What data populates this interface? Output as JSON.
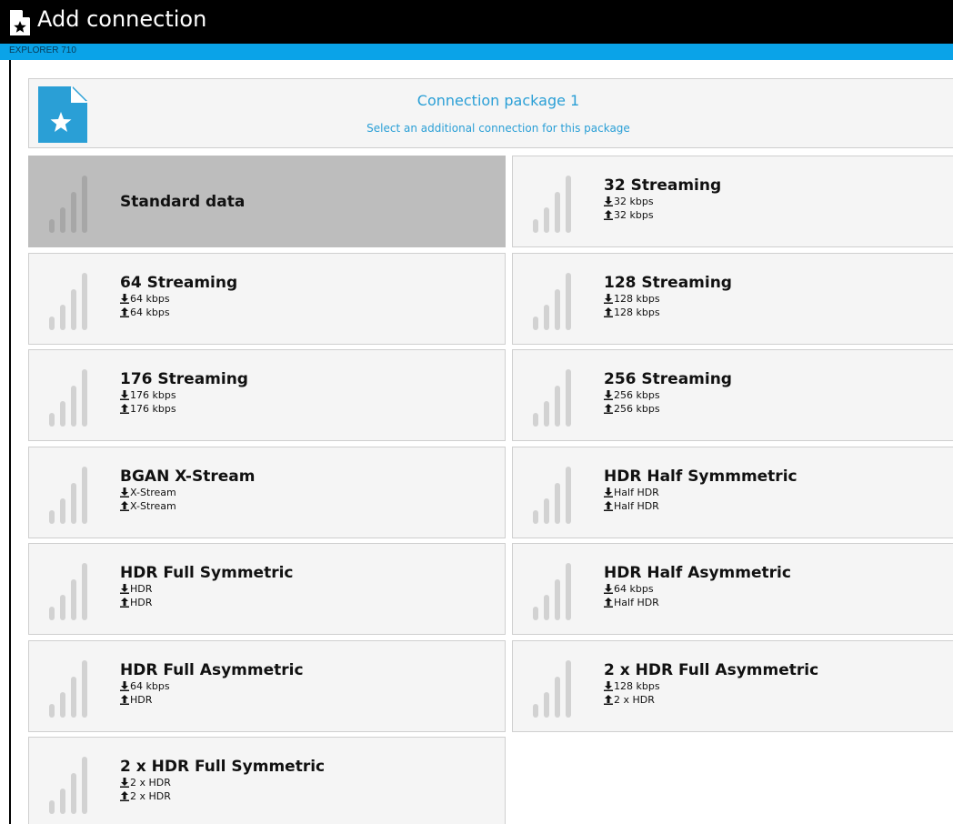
{
  "window": {
    "title": "Add connection",
    "app_icon": "star-document-icon"
  },
  "device": {
    "name": "EXPLORER 710"
  },
  "package": {
    "title": "Connection package 1",
    "subtitle": "Select an additional connection for this package",
    "icon": "star-document-icon"
  },
  "colors": {
    "accent": "#0aa3e8",
    "link_text": "#2a9fd6",
    "tile_bg": "#f5f5f5",
    "tile_selected_bg": "#bdbdbd",
    "signal_bars": "#d2d2d2"
  },
  "connections": [
    {
      "name": "Standard data",
      "selected": true
    },
    {
      "name": "32 Streaming",
      "download": "32 kbps",
      "upload": "32 kbps",
      "selected": false
    },
    {
      "name": "64 Streaming",
      "download": "64 kbps",
      "upload": "64 kbps",
      "selected": false
    },
    {
      "name": "128 Streaming",
      "download": "128 kbps",
      "upload": "128 kbps",
      "selected": false
    },
    {
      "name": "176 Streaming",
      "download": "176 kbps",
      "upload": "176 kbps",
      "selected": false
    },
    {
      "name": "256 Streaming",
      "download": "256 kbps",
      "upload": "256 kbps",
      "selected": false
    },
    {
      "name": "BGAN X-Stream",
      "download": "X-Stream",
      "upload": "X-Stream",
      "selected": false
    },
    {
      "name": "HDR Half Symmmetric",
      "download": "Half HDR",
      "upload": "Half HDR",
      "selected": false
    },
    {
      "name": "HDR Full Symmetric",
      "download": "HDR",
      "upload": "HDR",
      "selected": false
    },
    {
      "name": "HDR Half Asymmetric",
      "download": "64 kbps",
      "upload": "Half HDR",
      "selected": false
    },
    {
      "name": "HDR Full Asymmetric",
      "download": "64 kbps",
      "upload": "HDR",
      "selected": false
    },
    {
      "name": "2 x HDR Full Asymmetric",
      "download": "128 kbps",
      "upload": "2 x HDR",
      "selected": false
    },
    {
      "name": "2 x HDR Full Symmetric",
      "download": "2 x HDR",
      "upload": "2 x HDR",
      "selected": false
    }
  ]
}
